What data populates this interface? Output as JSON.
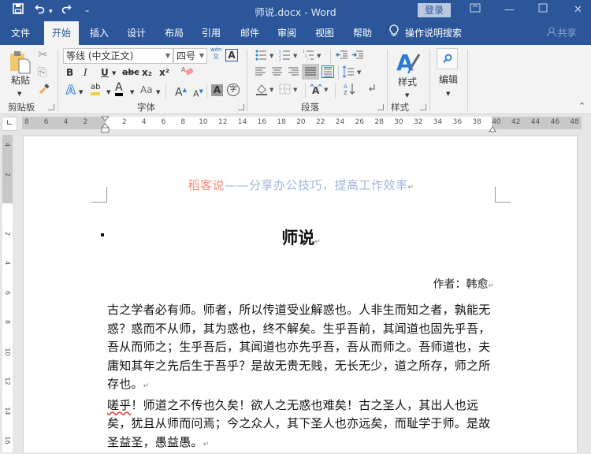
{
  "titlebar": {
    "quick_access": [
      {
        "name": "save-icon",
        "glyph": "🖫"
      },
      {
        "name": "undo-icon",
        "glyph": "↶"
      },
      {
        "name": "undo-dropdown-icon",
        "glyph": "▾"
      },
      {
        "name": "redo-icon",
        "glyph": "↷"
      },
      {
        "name": "customize-qat-icon",
        "glyph": "₌"
      }
    ],
    "document_title": "师说.docx  -  Word",
    "login_label": "登录",
    "ribbon_display_glyph": "⊡",
    "minimize_glyph": "—",
    "maximize_glyph": "☐",
    "close_glyph": "✕"
  },
  "tabs": [
    {
      "label": "文件",
      "active": false
    },
    {
      "label": "开始",
      "active": true
    },
    {
      "label": "插入",
      "active": false
    },
    {
      "label": "设计",
      "active": false
    },
    {
      "label": "布局",
      "active": false
    },
    {
      "label": "引用",
      "active": false
    },
    {
      "label": "邮件",
      "active": false
    },
    {
      "label": "审阅",
      "active": false
    },
    {
      "label": "视图",
      "active": false
    },
    {
      "label": "帮助",
      "active": false
    }
  ],
  "tell_me": {
    "icon": "lightbulb-icon",
    "label": "操作说明搜索"
  },
  "share": {
    "label": "共享",
    "icon": "person-icon"
  },
  "ribbon": {
    "clipboard": {
      "label": "剪贴板",
      "paste_label": "粘贴",
      "cut_glyph": "✂",
      "copy_glyph": "⎘",
      "format_painter_glyph": "🖌"
    },
    "font": {
      "label": "字体",
      "font_name": "等线 (中文正文)",
      "font_size": "四号",
      "phonetic_glyph": "wén文",
      "char_border_glyph": "A",
      "bold": "B",
      "italic": "I",
      "underline": "U",
      "strikethrough": "abc",
      "subscript": "x₂",
      "superscript": "x²",
      "clear_format_glyph": "⌫",
      "text_effects": "A",
      "highlight": "ab",
      "font_color": "A",
      "change_case": "Aa",
      "grow_font": "A˄",
      "shrink_font": "A˅",
      "char_shading": "A",
      "enclose_char": "字"
    },
    "paragraph": {
      "label": "段落"
    },
    "styles": {
      "label": "样式",
      "button_label": "样式"
    },
    "editing": {
      "button_label": "编辑"
    },
    "collapse_glyph": "⌃"
  },
  "ruler": {
    "corner_glyph": "∟",
    "h_ticks": [
      "8",
      "6",
      "4",
      "2",
      "",
      "2",
      "4",
      "6",
      "8",
      "10",
      "12",
      "14",
      "16",
      "18",
      "20",
      "22",
      "24",
      "26",
      "28",
      "30",
      "32",
      "34",
      "36",
      "38",
      "40",
      "42",
      "44",
      "46",
      "48"
    ],
    "v_ticks": [
      "4",
      "2",
      "",
      "2",
      "4",
      "6",
      "8",
      "10",
      "12",
      "14",
      "16"
    ]
  },
  "document": {
    "header_brand": "稻客说",
    "header_dash": "——",
    "header_slogan": "分享办公技巧，提高工作效率",
    "title": "师说",
    "author": "作者：韩愈",
    "paragraph_mark": "↵",
    "paragraphs": [
      "古之学者必有师。师者，所以传道受业解惑也。人非生而知之者，孰能无惑？惑而不从师，其为惑也，终不解矣。生乎吾前，其闻道也固先乎吾，吾从而师之；生乎吾后，其闻道也亦先乎吾，吾从而师之。吾师道也，夫庸知其年之先后生于吾乎？是故无贵无贱，无长无少，道之所存，师之所存也。",
      "嗟乎！师道之不传也久矣！欲人之无惑也难矣！古之圣人，其出人也远矣，犹且从师而问焉；今之众人，其下圣人也亦远矣，而耻学于师。是故圣益圣，愚益愚。"
    ],
    "para2_first_word": "嗟乎",
    "para2_rest": "！师道之不传也久矣！欲人之无惑也难矣！古之圣人，其出人也远矣，犹且从师而问焉；今之众人，其下圣人也亦远矣，而耻学于师。是故圣益圣，愚益愚。"
  },
  "colors": {
    "brand_blue": "#2b579a",
    "header_brand_color": "#f0907a",
    "header_slogan_color": "#9fb6dd"
  }
}
